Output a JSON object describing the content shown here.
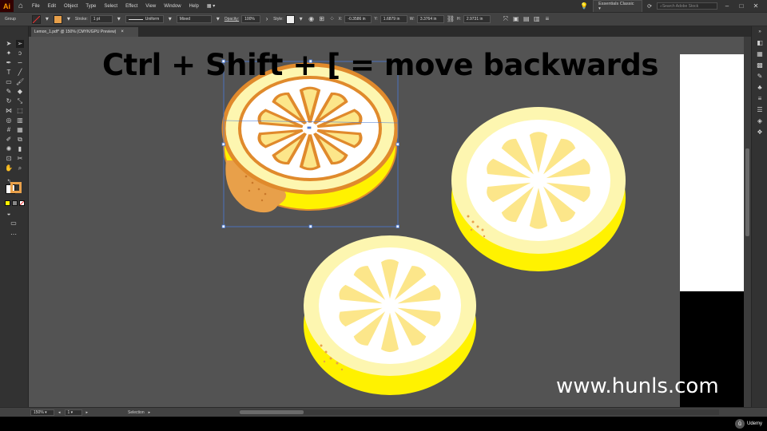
{
  "app": {
    "logo": "Ai",
    "workspace": "Essentials Classic",
    "search_placeholder": "Search Adobe Stock"
  },
  "menu": [
    "File",
    "Edit",
    "Object",
    "Type",
    "Select",
    "Effect",
    "View",
    "Window",
    "Help"
  ],
  "control": {
    "selection_type": "Group",
    "stroke_label": "Stroke:",
    "stroke_weight": "1 pt",
    "stroke_profile": "Uniform",
    "brush": "Mixed",
    "opacity_label": "Opacity:",
    "opacity_value": "100%",
    "style_label": "Style:",
    "x": "-0.3586 in",
    "y": "1.6879 in",
    "w": "3.3764 in",
    "h": "2.9731 in"
  },
  "document": {
    "tab_title": "Lemon_1.pdf* @ 150% (CMYK/GPU Preview)",
    "close": "×"
  },
  "overlay": {
    "title": "Ctrl + Shift + [ = move backwards",
    "watermark": "www.hunls.com"
  },
  "status": {
    "zoom": "150%",
    "artboard": "1",
    "mode": "Selection"
  },
  "branding": {
    "udemy": "Udemy"
  },
  "colors": {
    "fill_swatch": "#e8a04a",
    "lemon_yellow": "#fff200",
    "lemon_rind": "#fdf6b0",
    "lemon_flesh": "#fce68a",
    "orange_outline": "#e08a2c",
    "selection_blue": "#4a7bd6"
  }
}
